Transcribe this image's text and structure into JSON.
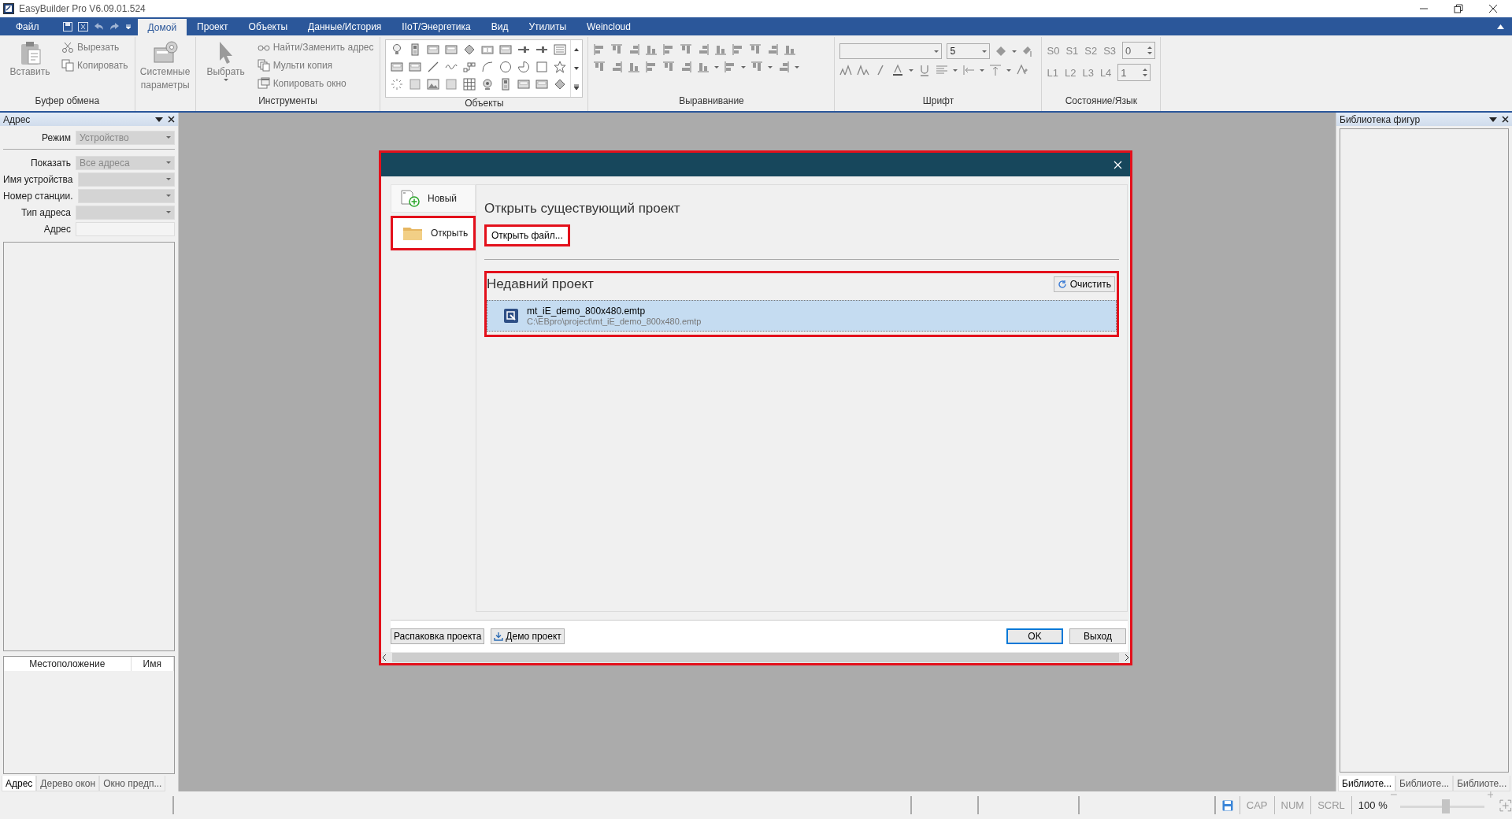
{
  "window": {
    "title": "EasyBuilder Pro V6.09.01.524"
  },
  "file_menu": {
    "label": "Файл"
  },
  "tabs": [
    {
      "label": "Домой",
      "selected": true
    },
    {
      "label": "Проект",
      "selected": false
    },
    {
      "label": "Объекты",
      "selected": false
    },
    {
      "label": "Данные/История",
      "selected": false
    },
    {
      "label": "IIoT/Энергетика",
      "selected": false
    },
    {
      "label": "Вид",
      "selected": false
    },
    {
      "label": "Утилиты",
      "selected": false
    },
    {
      "label": "Weincloud",
      "selected": false
    }
  ],
  "ribbon": [
    {
      "kind": "buttons",
      "label": "Буфер обмена",
      "items": [
        {
          "kind": "large",
          "text": "Вставить",
          "disabled": true
        },
        {
          "kind": "small",
          "text": "Вырезать",
          "disabled": true
        },
        {
          "kind": "small",
          "text": "Копировать",
          "disabled": true
        }
      ]
    },
    {
      "kind": "buttons",
      "items": [
        {
          "kind": "large",
          "text": "Системные параметры",
          "disabled": true
        }
      ]
    },
    {
      "kind": "buttons",
      "label": "Инструменты",
      "items": [
        {
          "kind": "large",
          "text": "Выбрать",
          "disabled": true
        },
        {
          "kind": "small",
          "text": "Найти/Заменить адрес",
          "disabled": true
        },
        {
          "kind": "small",
          "text": "Мульти копия",
          "disabled": true
        },
        {
          "kind": "small",
          "text": "Копировать окно",
          "disabled": true
        }
      ]
    },
    {
      "kind": "gallery",
      "label": "Объекты"
    },
    {
      "kind": "align",
      "label": "Выравнивание"
    },
    {
      "kind": "font",
      "label": "Шрифт",
      "size": "5"
    },
    {
      "kind": "state",
      "label": "Состояние/Язык",
      "rows": [
        {
          "labels": [
            "S0",
            "S1",
            "S2",
            "S3"
          ],
          "value": "0"
        },
        {
          "labels": [
            "L1",
            "L2",
            "L3",
            "L4"
          ],
          "value": "1"
        }
      ]
    }
  ],
  "left_panel": {
    "title": "Адрес",
    "mode": {
      "label": "Режим",
      "value": "Устройство"
    },
    "fields": [
      {
        "kind": "dropdown",
        "label": "Показать",
        "value": "Все адреса"
      },
      {
        "kind": "dropdown",
        "label": "Имя устройства"
      },
      {
        "kind": "dropdown",
        "label": "Номер станции."
      },
      {
        "kind": "dropdown",
        "label": "Тип адреса"
      },
      {
        "kind": "text",
        "label": "Адрес"
      }
    ],
    "table": {
      "columns": [
        "Местоположение",
        "Имя"
      ]
    },
    "tabs": [
      {
        "label": "Адрес",
        "selected": true
      },
      {
        "label": "Дерево окон",
        "selected": false
      },
      {
        "label": "Окно предп...",
        "selected": false
      }
    ]
  },
  "right_panel": {
    "title": "Библиотека фигур",
    "tabs": [
      {
        "label": "Библиоте...",
        "selected": true
      },
      {
        "label": "Библиоте...",
        "selected": false
      },
      {
        "label": "Библиоте...",
        "selected": false
      }
    ]
  },
  "dialog": {
    "highlighted": true,
    "nav": [
      {
        "label": "Новый",
        "selected": false,
        "highlighted": false
      },
      {
        "label": "Открыть",
        "selected": true,
        "highlighted": true
      }
    ],
    "heading": "Открыть существующий проект",
    "open_button": {
      "label": "Открыть файл...",
      "highlighted": true
    },
    "recent": {
      "title": "Недавний проект",
      "highlighted": true,
      "clear_button": "Очистить",
      "items": [
        {
          "name": "mt_iE_demo_800x480.emtp",
          "path": "C:\\EBpro\\project\\mt_iE_demo_800x480.emtp",
          "selected": true
        }
      ]
    },
    "footer_buttons": [
      {
        "label": "Распаковка проекта",
        "kind": "plain"
      },
      {
        "label": "Демо проект",
        "kind": "download"
      },
      {
        "label": "OK",
        "kind": "default"
      },
      {
        "label": "Выход",
        "kind": "plain"
      }
    ]
  },
  "status_bar": {
    "indicators": [
      {
        "text": "CAP",
        "active": false
      },
      {
        "text": "NUM",
        "active": false
      },
      {
        "text": "SCRL",
        "active": false
      }
    ],
    "zoom": "100 %",
    "zoom_slider": {
      "level": 0.55
    }
  }
}
